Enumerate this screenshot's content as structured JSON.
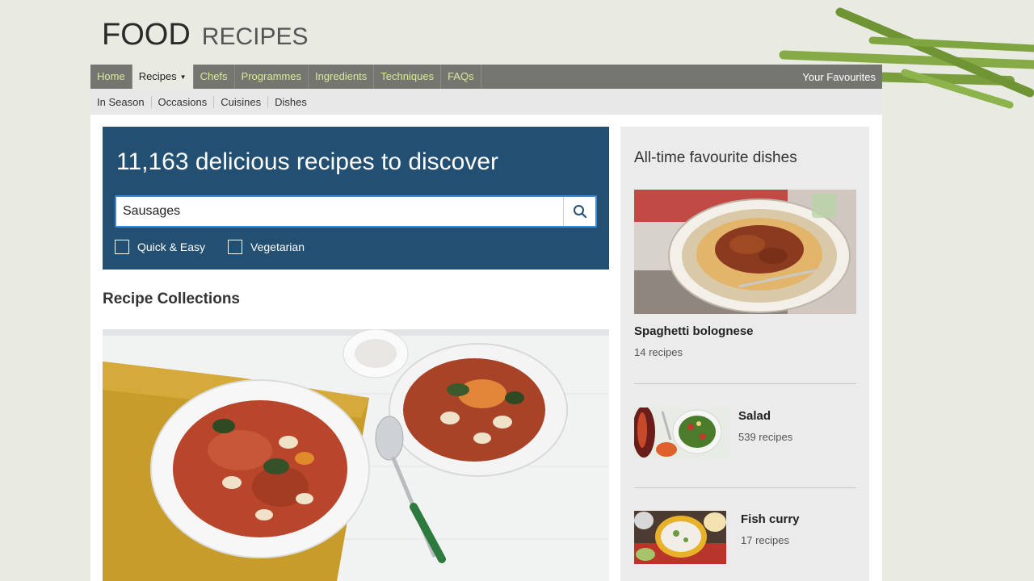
{
  "logo": {
    "word1": "FOOD",
    "word2": "RECIPES"
  },
  "nav": {
    "items": [
      {
        "label": "Home"
      },
      {
        "label": "Recipes"
      },
      {
        "label": "Chefs"
      },
      {
        "label": "Programmes"
      },
      {
        "label": "Ingredients"
      },
      {
        "label": "Techniques"
      },
      {
        "label": "FAQs"
      }
    ],
    "favourites": "Your Favourites",
    "active": "Recipes"
  },
  "subnav": {
    "items": [
      "In Season",
      "Occasions",
      "Cuisines",
      "Dishes"
    ]
  },
  "hero": {
    "title": "11,163 delicious recipes to discover",
    "search_value": "Sausages",
    "filters": [
      "Quick & Easy",
      "Vegetarian"
    ]
  },
  "collections": {
    "title": "Recipe Collections"
  },
  "sidebar": {
    "title": "All-time favourite dishes",
    "featured": {
      "name": "Spaghetti bolognese",
      "count": "14 recipes"
    },
    "items": [
      {
        "name": "Salad",
        "count": "539 recipes"
      },
      {
        "name": "Fish curry",
        "count": "17 recipes"
      }
    ]
  },
  "colors": {
    "nav_bg": "#767670",
    "nav_link": "#d6eb9a",
    "hero_bg": "#224f72",
    "search_border": "#3b8bd6"
  },
  "icons": {
    "search": "search-icon",
    "dropdown": "caret-down-icon"
  }
}
